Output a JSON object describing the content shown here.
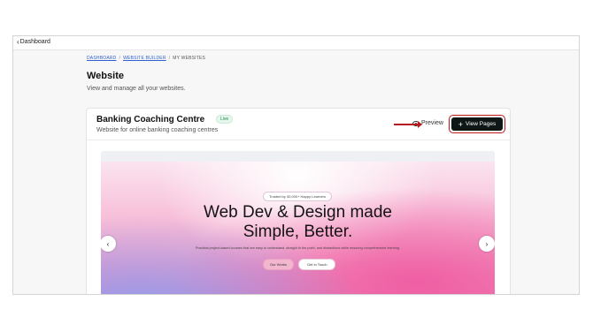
{
  "topbar": {
    "back_label": "Dashboard"
  },
  "breadcrumb": [
    "DASHBOARD",
    "WEBSITE BUILDER",
    "MY WEBSITES"
  ],
  "page": {
    "title": "Website",
    "subtitle": "View and manage all your websites."
  },
  "website": {
    "name": "Banking Coaching Centre",
    "status": "Live",
    "description": "Website for online banking coaching centres",
    "preview_label": "Preview",
    "view_pages_label": "View Pages"
  },
  "hero": {
    "trusted": "Trusted by 30,000+ Happy Learners",
    "headline_line1": "Web Dev & Design made",
    "headline_line2": "Simple, Better.",
    "paragraph": "Practical project-based courses that are easy to understand, straight to the point, and distractions while ensuring comprehensive learning.",
    "btn_primary": "Our Works",
    "btn_secondary": "Get in Touch"
  },
  "icons": {
    "back": "chevron-left-icon",
    "preview": "eye-icon",
    "add": "plus-icon",
    "prev": "chevron-left-icon",
    "next": "chevron-right-icon"
  },
  "colors": {
    "accent": "#0f1716",
    "highlight": "#c2181b",
    "live": "#1f8a4c",
    "link": "#2f5fd0"
  }
}
